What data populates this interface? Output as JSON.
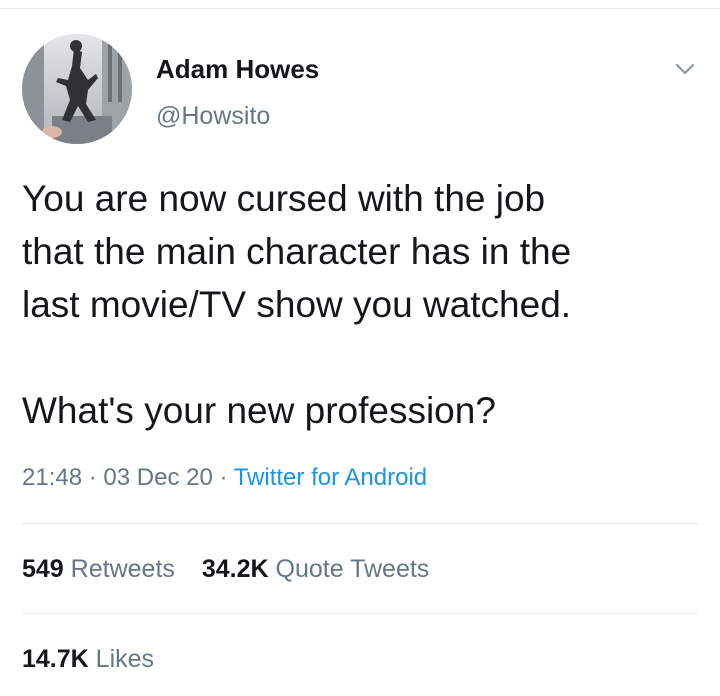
{
  "tweet": {
    "author": {
      "name": "Adam Howes",
      "handle": "@Howsito"
    },
    "text_lines": [
      "You are now cursed with the job\nthat the main character has in the\nlast movie/TV show you watched.",
      "What's your new profession?"
    ],
    "time": "21:48",
    "date": "03 Dec 20",
    "separator": "·",
    "source": "Twitter for Android",
    "stats": {
      "retweets_count": "549",
      "retweets_label": "Retweets",
      "quotes_count": "34.2K",
      "quotes_label": "Quote Tweets",
      "likes_count": "14.7K",
      "likes_label": "Likes"
    }
  },
  "colors": {
    "text": "#14171a",
    "secondary": "#657786",
    "link": "#1b95e0",
    "divider": "#e6ecf0"
  },
  "icons": {
    "menu": "chevron-down-icon"
  }
}
